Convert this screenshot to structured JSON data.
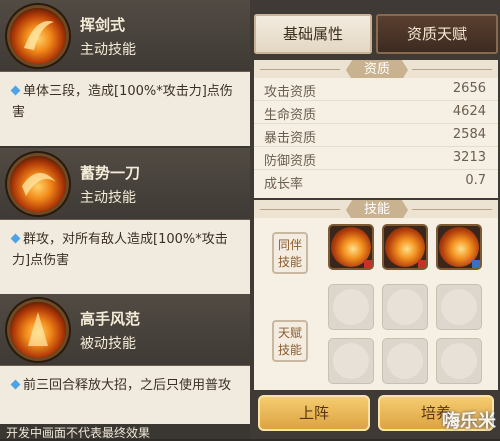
{
  "skills": [
    {
      "name": "挥剑式",
      "type": "主动技能",
      "icon": "sword-slash-icon",
      "desc": "单体三段，造成[100%*攻击力]点伤害"
    },
    {
      "name": "蓄势一刀",
      "type": "主动技能",
      "icon": "charged-blade-icon",
      "desc": "群攻，对所有敌人造成[100%*攻击力]点伤害"
    },
    {
      "name": "高手风范",
      "type": "被动技能",
      "icon": "master-aura-icon",
      "desc": "前三回合释放大招，之后只使用普攻"
    }
  ],
  "footnote": "开发中画面不代表最终效果",
  "tabs": {
    "basic": "基础属性",
    "aptitude": "资质天赋"
  },
  "sections": {
    "aptitude": "资质",
    "skills": "技能"
  },
  "stats": [
    {
      "label": "攻击资质",
      "value": "2656"
    },
    {
      "label": "生命资质",
      "value": "4624"
    },
    {
      "label": "暴击资质",
      "value": "2584"
    },
    {
      "label": "防御资质",
      "value": "3213"
    },
    {
      "label": "成长率",
      "value": "0.7"
    }
  ],
  "skill_groups": {
    "partner": "同伴技能",
    "talent": "天赋技能"
  },
  "buttons": {
    "deploy": "上阵",
    "train": "培养"
  },
  "watermark": "嗨乐米",
  "colors": {
    "button": "#e8b556",
    "tab_active": "#4a3426",
    "accent_blue": "#4da3e8"
  }
}
